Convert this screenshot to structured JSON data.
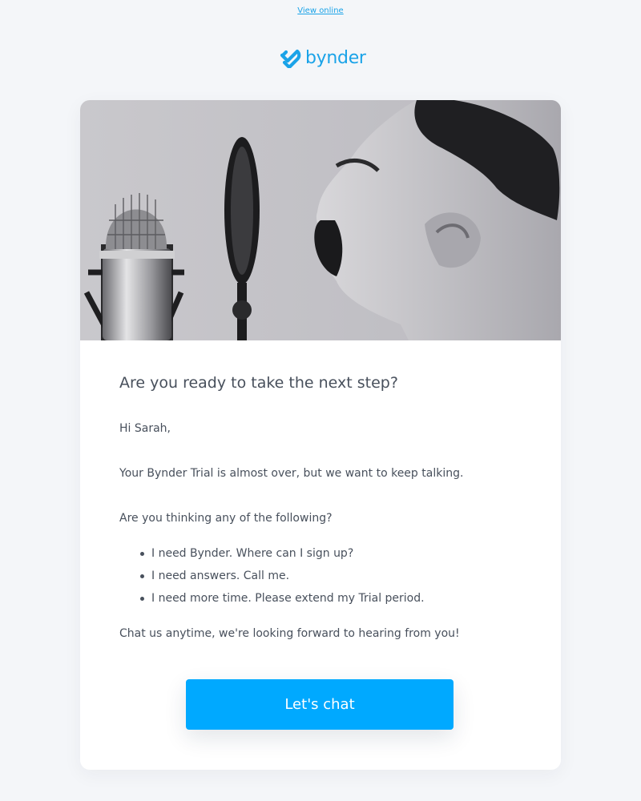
{
  "header": {
    "view_online": "View online",
    "logo_text": "bynder"
  },
  "hero": {
    "icon": "microphone-photo"
  },
  "email": {
    "heading": "Are you ready to take the next step?",
    "greeting": "Hi Sarah,",
    "intro": "Your Bynder Trial is almost over, but we want to keep talking.",
    "question": "Are you thinking any of the following?",
    "options": [
      "I need Bynder. Where can I sign up?",
      "I need answers. Call me.",
      "I need more time. Please extend my Trial period."
    ],
    "closing": "Chat us anytime, we're looking forward to hearing from you!",
    "cta_label": "Let's chat"
  },
  "colors": {
    "background": "#f4f6f9",
    "brand": "#1aa3e8",
    "button": "#00a9ff",
    "text": "#48505c"
  }
}
